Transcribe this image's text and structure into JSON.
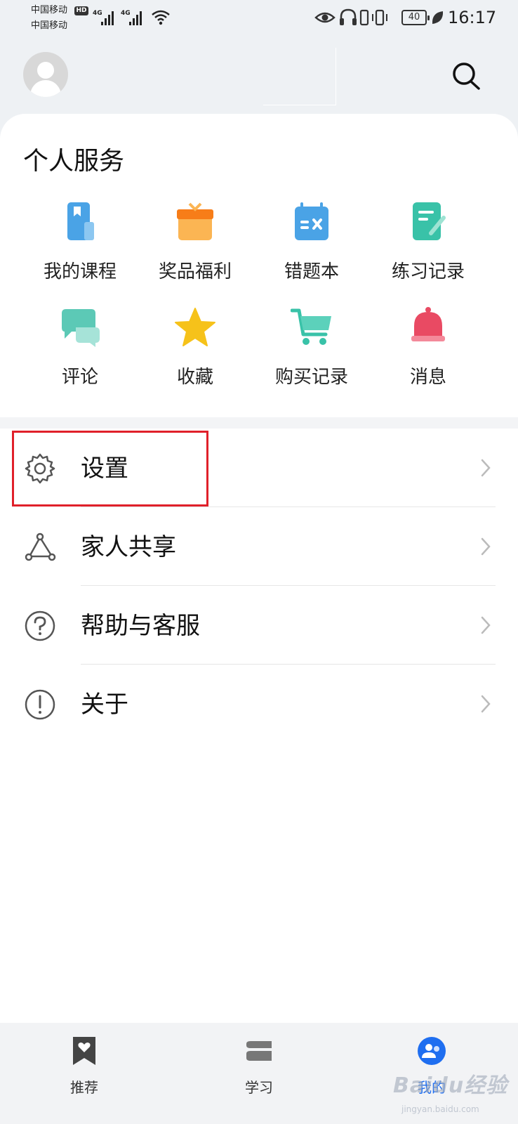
{
  "status_bar": {
    "carrier_1": "中国移动",
    "carrier_2": "中国移动",
    "hd_label": "HD",
    "net_type_1": "4G",
    "net_type_2": "4G",
    "battery_level": "40",
    "time": "16:17"
  },
  "header": {
    "avatar_icon": "default-user-avatar",
    "search_icon": "search-icon"
  },
  "services": {
    "title": "个人服务",
    "items": [
      {
        "label": "我的课程",
        "icon": "book-icon",
        "color": "#4aa3e6"
      },
      {
        "label": "奖品福利",
        "icon": "gift-icon",
        "color": "#f7a240"
      },
      {
        "label": "错题本",
        "icon": "calendar-wrong-icon",
        "color": "#4aa3e6"
      },
      {
        "label": "练习记录",
        "icon": "note-pen-icon",
        "color": "#39c2a8"
      },
      {
        "label": "评论",
        "icon": "chat-bubble-icon",
        "color": "#5cc9b6"
      },
      {
        "label": "收藏",
        "icon": "star-icon",
        "color": "#f6c21a"
      },
      {
        "label": "购买记录",
        "icon": "cart-icon",
        "color": "#39c2a8"
      },
      {
        "label": "消息",
        "icon": "bell-icon",
        "color": "#e94a63"
      }
    ]
  },
  "menu": {
    "items": [
      {
        "label": "设置",
        "icon": "gear-icon"
      },
      {
        "label": "家人共享",
        "icon": "share-nodes-icon"
      },
      {
        "label": "帮助与客服",
        "icon": "help-circle-icon"
      },
      {
        "label": "关于",
        "icon": "info-exclamation-icon"
      }
    ]
  },
  "bottom_nav": {
    "tabs": [
      {
        "label": "推荐",
        "icon": "bookmark-heart-icon"
      },
      {
        "label": "学习",
        "icon": "stack-icon"
      },
      {
        "label": "我的",
        "icon": "profile-icon",
        "active": true
      }
    ]
  },
  "watermark": {
    "text": "Baidu经验",
    "sub": "jingyan.baidu.com"
  },
  "colors": {
    "accent": "#1f6ef0",
    "highlight": "#e0202a",
    "background": "#eef1f4"
  }
}
